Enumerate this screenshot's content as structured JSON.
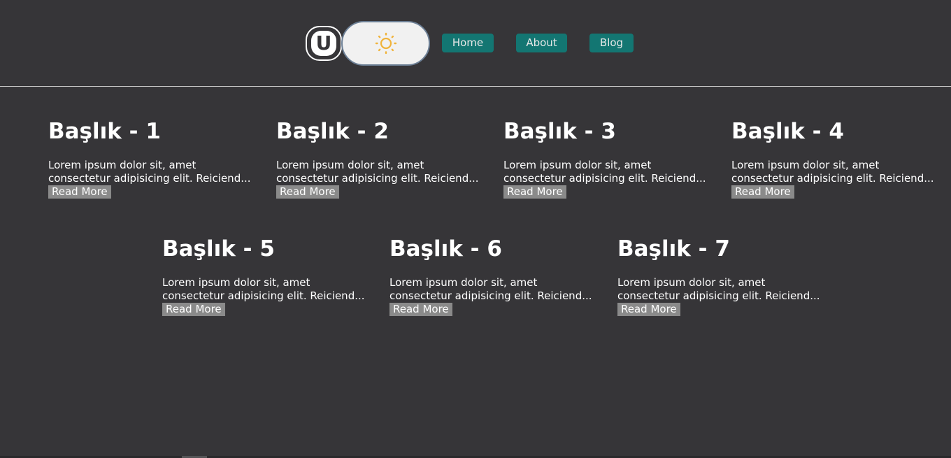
{
  "header": {
    "logo_letter": "U",
    "theme_icon": "sun-icon",
    "colors": {
      "background": "#363538",
      "nav_button": "#137672",
      "toggle_background": "#f1f1f1",
      "sun": "#f0b33a",
      "read_more": "#8a8a8a"
    },
    "nav": [
      {
        "label": "Home"
      },
      {
        "label": "About"
      },
      {
        "label": "Blog"
      }
    ]
  },
  "cards": [
    {
      "title": "Başlık - 1",
      "text": "Lorem ipsum dolor sit, amet consectetur adipisicing elit. Reiciend...",
      "link": "Read More"
    },
    {
      "title": "Başlık - 2",
      "text": "Lorem ipsum dolor sit, amet consectetur adipisicing elit. Reiciend...",
      "link": "Read More"
    },
    {
      "title": "Başlık - 3",
      "text": "Lorem ipsum dolor sit, amet consectetur adipisicing elit. Reiciend...",
      "link": "Read More"
    },
    {
      "title": "Başlık - 4",
      "text": "Lorem ipsum dolor sit, amet consectetur adipisicing elit. Reiciend...",
      "link": "Read More"
    },
    {
      "title": "Başlık - 5",
      "text": "Lorem ipsum dolor sit, amet consectetur adipisicing elit. Reiciend...",
      "link": "Read More"
    },
    {
      "title": "Başlık - 6",
      "text": "Lorem ipsum dolor sit, amet consectetur adipisicing elit. Reiciend...",
      "link": "Read More"
    },
    {
      "title": "Başlık - 7",
      "text": "Lorem ipsum dolor sit, amet consectetur adipisicing elit. Reiciend...",
      "link": "Read More"
    }
  ]
}
